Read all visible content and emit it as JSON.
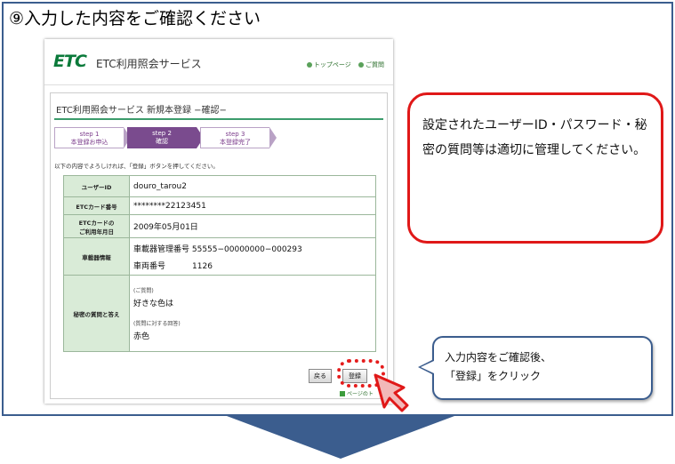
{
  "heading": "⑨入力した内容をご確認ください",
  "site": {
    "logo": "ETC",
    "service_name": "ETC利用照会サービス",
    "links": [
      "トップページ",
      "ご質問"
    ]
  },
  "form": {
    "title": "ETC利用照会サービス 新規本登録 −確認−",
    "steps": [
      {
        "num": "step 1",
        "label": "本登録お申込"
      },
      {
        "num": "step 2",
        "label": "確認"
      },
      {
        "num": "step 3",
        "label": "本登録完了"
      }
    ],
    "instruction": "以下の内容でよろしければ、「登録」ボタンを押してください。",
    "rows": {
      "user_id": {
        "label": "ユーザーID",
        "value": "douro_tarou2"
      },
      "card_no": {
        "label": "ETCカード番号",
        "value": "********22123451"
      },
      "start_date": {
        "label1": "ETCカードの",
        "label2": "ご利用年月日",
        "value": "2009年05月01日"
      },
      "vehicle": {
        "label": "車載器情報",
        "line1": "車載器管理番号 55555−00000000−000293",
        "line2_label": "車両番号",
        "line2_value": "1126"
      },
      "secret": {
        "label": "秘密の質問と答え",
        "q_caption": "(ご質問)",
        "question": "好きな色は",
        "a_caption": "(質問に対する回答)",
        "answer": "赤色"
      }
    },
    "back_button": "戻る",
    "register_button": "登録",
    "page_top": "ページのト"
  },
  "callout_main": "設定されたユーザーID・パスワード・秘密の質問等は適切に管理してください。",
  "callout_action": {
    "line1": "入力内容をご確認後、",
    "line2": "「登録」をクリック"
  },
  "colors": {
    "frame": "#3b5d8e",
    "alert": "#e01818",
    "step_active": "#7a4b8e",
    "label_bg": "#d9ebd7"
  }
}
